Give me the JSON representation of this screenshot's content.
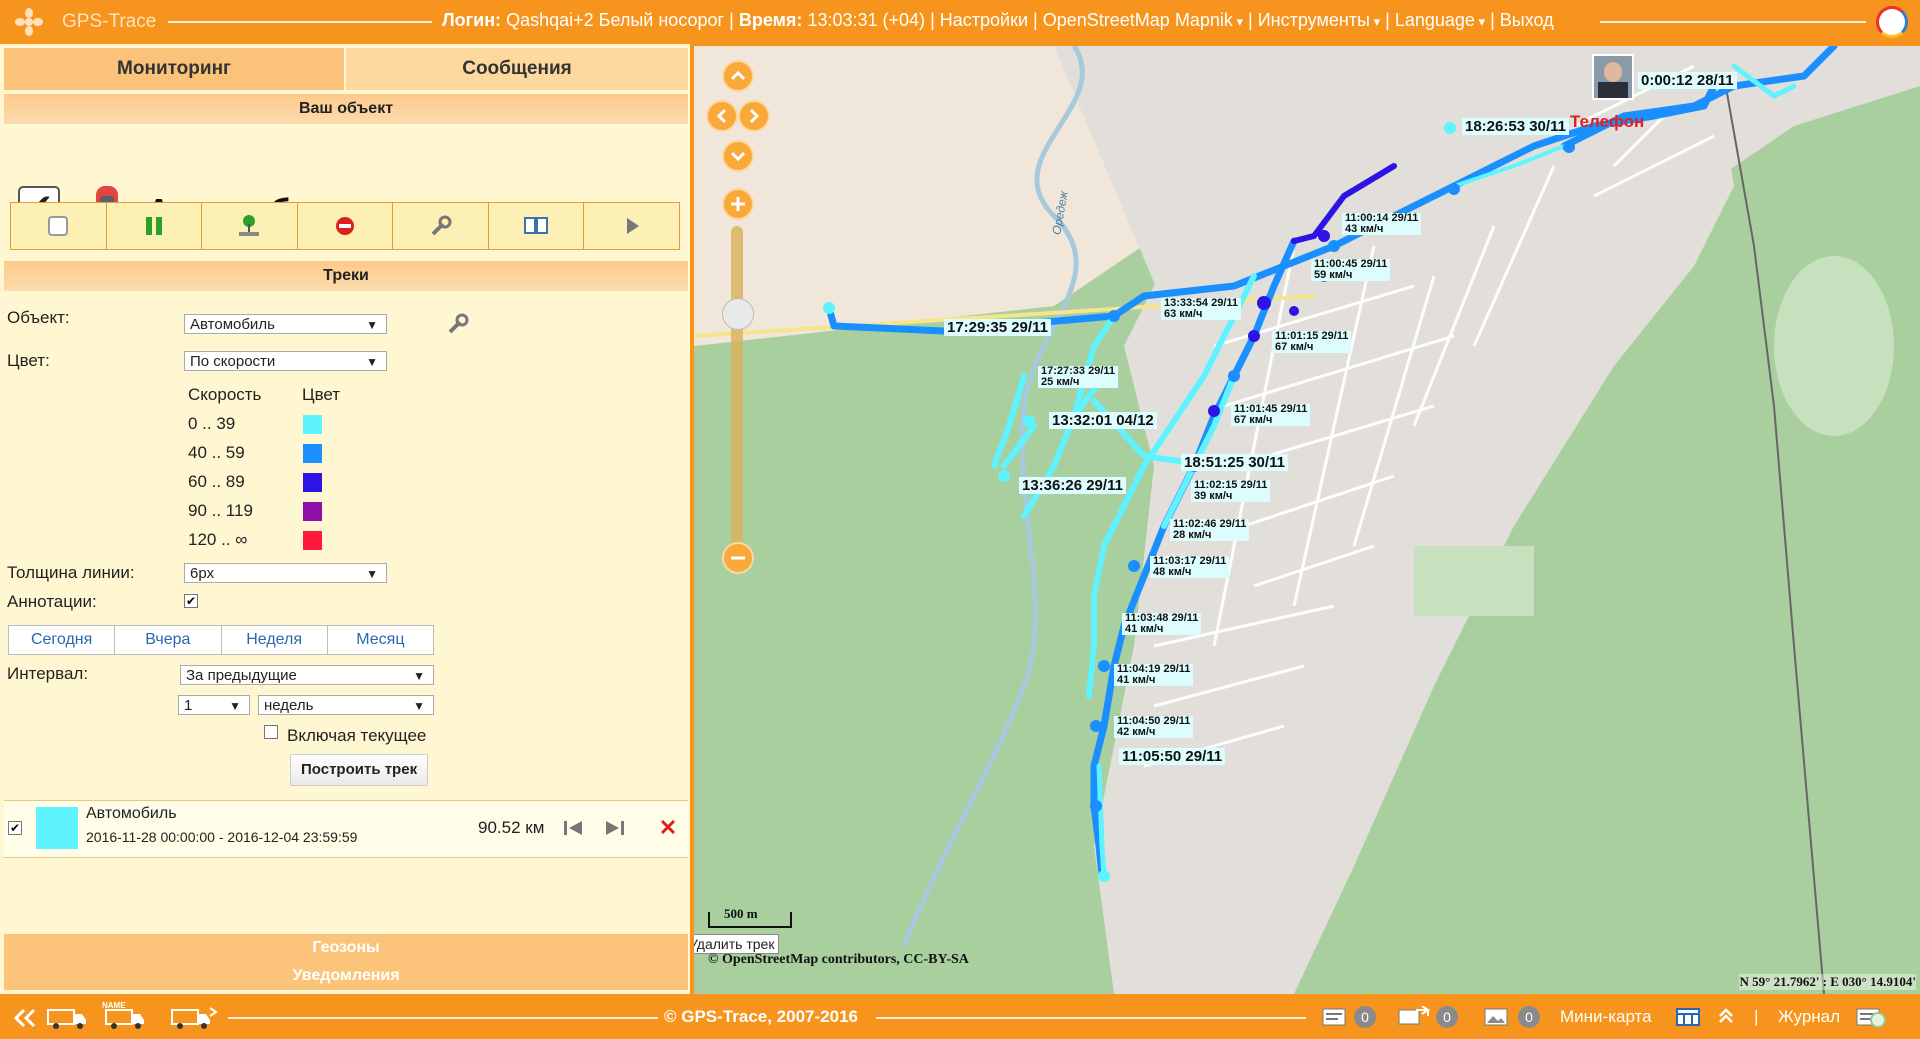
{
  "header": {
    "app_name": "GPS-Trace",
    "login_label": "Логин:",
    "login_value": "Qashqai+2 Белый носорог",
    "time_label": "Время:",
    "time_value": "13:03:31 (+04)",
    "settings": "Настройки",
    "map_layer": "OpenStreetMap Mapnik",
    "tools": "Инструменты",
    "language": "Language",
    "logout": "Выход",
    "sep": "|"
  },
  "tabs": [
    "Мониторинг",
    "Сообщения"
  ],
  "your_object": {
    "title": "Ваш объект",
    "name": "Автомобиль",
    "toolbar_icons": [
      "stop-icon",
      "pause-icon",
      "geo-point-icon",
      "block-icon",
      "wrench-icon",
      "book-icon",
      "play-icon"
    ]
  },
  "tracks": {
    "title": "Треки",
    "object_label": "Объект:",
    "object_value": "Автомобиль",
    "color_label": "Цвет:",
    "color_value": "По скорости",
    "speed_header": "Скорость",
    "color_header": "Цвет",
    "speed_legend": [
      {
        "range": "0 .. 39",
        "color": "#5ff3ff"
      },
      {
        "range": "40 .. 59",
        "color": "#1a8fff"
      },
      {
        "range": "60 .. 89",
        "color": "#2c14e4"
      },
      {
        "range": "90 .. 119",
        "color": "#8e0fa8"
      },
      {
        "range": "120 .. ∞",
        "color": "#ff1a3c"
      }
    ],
    "thickness_label": "Толщина линии:",
    "thickness_value": "6px",
    "annotations_label": "Аннотации:",
    "periods": [
      "Сегодня",
      "Вчера",
      "Неделя",
      "Месяц"
    ],
    "interval_label": "Интервал:",
    "interval_value": "За предыдущие",
    "interval_count": "1",
    "interval_unit": "недель",
    "include_current": "Включая текущее",
    "build_button": "Построить трек",
    "track_item": {
      "name": "Автомобиль",
      "dates": "2016-11-28 00:00:00 - 2016-12-04 23:59:59",
      "distance": "90.52 км",
      "swatch_color": "#5ff3ff"
    }
  },
  "sections": [
    "Геозоны",
    "Уведомления"
  ],
  "map": {
    "phone_label": "Телефон",
    "phone_time": "0:00:12 28/11",
    "labels_big": [
      "18:26:53 30/11",
      "17:29:35 29/11",
      "13:32:01 04/12",
      "18:51:25 30/11",
      "13:36:26 29/11",
      "11:05:50 29/11"
    ],
    "labels_small": [
      [
        "11:00:14 29/11",
        "43 км/ч"
      ],
      [
        "11:00:45 29/11",
        "59 км/ч"
      ],
      [
        "13:33:54 29/11",
        "63 км/ч"
      ],
      [
        "11:01:15 29/11",
        "67 км/ч"
      ],
      [
        "17:27:33 29/11",
        "25 км/ч"
      ],
      [
        "11:01:45 29/11",
        "67 км/ч"
      ],
      [
        "11:02:15 29/11",
        "39 км/ч"
      ],
      [
        "11:02:46 29/11",
        "28 км/ч"
      ],
      [
        "11:03:17 29/11",
        "48 км/ч"
      ],
      [
        "11:03:48 29/11",
        "41 км/ч"
      ],
      [
        "11:04:19 29/11",
        "41 км/ч"
      ],
      [
        "11:04:50 29/11",
        "42 км/ч"
      ]
    ],
    "street_label": "Оредеж",
    "scale": "500 m",
    "tooltip": "Удалить трек",
    "attribution": "© OpenStreetMap contributors, CC-BY-SA",
    "coords": "N 59° 21.7962' : E 030° 14.9104'"
  },
  "footer": {
    "copyright": "© GPS-Trace, 2007-2016",
    "count1": "0",
    "count2": "0",
    "count3": "0",
    "minimap": "Мини-карта",
    "journal": "Журнал",
    "sep": "|"
  }
}
